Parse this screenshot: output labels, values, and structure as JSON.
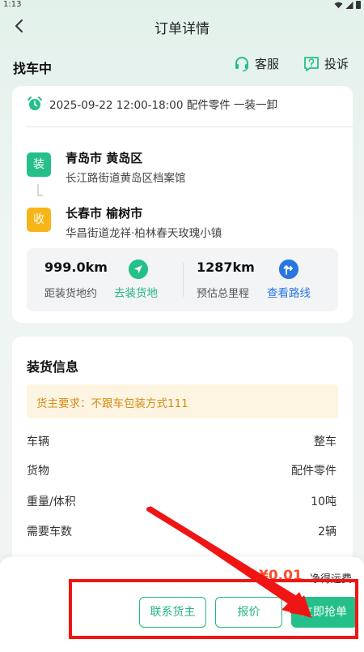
{
  "statusbar": {
    "time": "1:13"
  },
  "header": {
    "title": "订单详情"
  },
  "status": {
    "text": "找车中",
    "service_label": "客服",
    "complaint_label": "投诉"
  },
  "order": {
    "time_info": "2025-09-22 12:00-18:00 配件零件 一装一卸",
    "load": {
      "tag": "装",
      "city": "青岛市 黄岛区",
      "detail": "长江路街道黄岛区档案馆"
    },
    "unload": {
      "tag": "收",
      "city": "长春市 榆树市",
      "detail": "华昌街道龙祥·柏林春天玫瑰小镇"
    },
    "distance": {
      "to_load_value": "999.0km",
      "to_load_label": "距装货地约",
      "to_load_link": "去装货地",
      "total_value": "1287km",
      "total_label": "预估总里程",
      "total_link": "查看路线"
    }
  },
  "loading_info": {
    "title": "装货信息",
    "requirement": "货主要求：不跟车包装方式111",
    "rows": [
      {
        "key": "车辆",
        "value": "整车"
      },
      {
        "key": "货物",
        "value": "配件零件"
      },
      {
        "key": "重量/体积",
        "value": "10吨"
      },
      {
        "key": "需要车数",
        "value": "2辆"
      }
    ]
  },
  "footer": {
    "price": "¥0.01",
    "price_label": "净得运费",
    "contact_button": "联系货主",
    "quote_button": "报价",
    "grab_button": "立即抢单"
  },
  "colors": {
    "primary": "#25c08a",
    "link_blue": "#2a76e0",
    "warning_text": "#d58a12",
    "price_red": "#ff4b2b",
    "annotation_red": "#f01515"
  }
}
